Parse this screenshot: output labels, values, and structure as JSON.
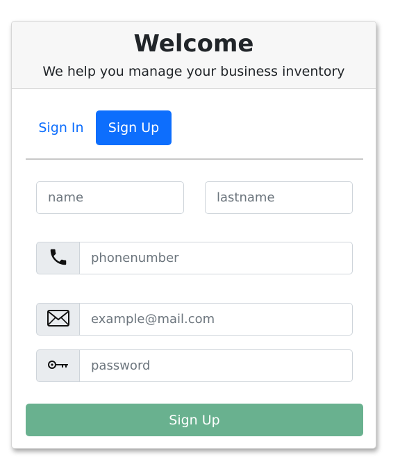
{
  "header": {
    "title": "Welcome",
    "subtitle": "We help you manage your business inventory"
  },
  "tabs": [
    {
      "label": "Sign In",
      "active": false
    },
    {
      "label": "Sign Up",
      "active": true
    }
  ],
  "form": {
    "name": {
      "placeholder": "name",
      "value": ""
    },
    "lastname": {
      "placeholder": "lastname",
      "value": ""
    },
    "phone": {
      "placeholder": "phonenumber",
      "value": "",
      "icon": "phone-icon"
    },
    "email": {
      "placeholder": "example@mail.com",
      "value": "",
      "icon": "envelope-icon"
    },
    "password": {
      "placeholder": "password",
      "value": "",
      "icon": "key-icon"
    },
    "submit_label": "Sign Up"
  },
  "colors": {
    "primary": "#0d6efd",
    "submit": "#69b18f",
    "header_bg": "#f7f7f7",
    "addon_bg": "#e9ecef"
  }
}
